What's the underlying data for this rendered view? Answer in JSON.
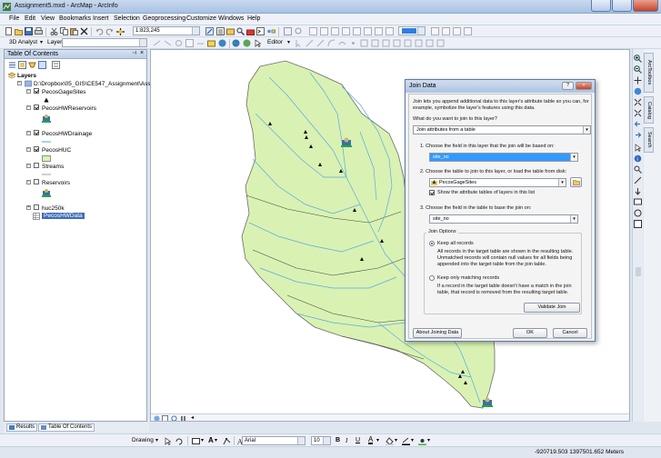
{
  "window": {
    "title": "Assignment5.mxd - ArcMap - ArcInfo"
  },
  "menu": {
    "items": [
      "File",
      "Edit",
      "View",
      "Bookmarks",
      "Insert",
      "Selection",
      "Geoprocessing",
      "Customize",
      "Windows",
      "Help"
    ]
  },
  "toolbar": {
    "scale": "1:823,245",
    "analyst_label": "3D Analyst",
    "layer_label": "Layer:",
    "editor_label": "Editor"
  },
  "toc": {
    "title": "Table Of Contents",
    "root": "Layers",
    "group": "D:\\Dropbox\\05_GIS\\CE547_Assignment\\Assignm",
    "layers": [
      {
        "label": "PecosGageSites",
        "checked": true
      },
      {
        "label": "PecosHWReservoirs",
        "checked": true
      },
      {
        "label": "PecosHWDrainage",
        "checked": true
      },
      {
        "label": "PecosHUC",
        "checked": true
      },
      {
        "label": "Streams",
        "checked": false
      },
      {
        "label": "Reservoirs",
        "checked": false
      },
      {
        "label": "huc250k",
        "checked": false
      },
      {
        "label": "PecosHWData",
        "checked": false
      }
    ]
  },
  "bottom_tabs": {
    "results": "Results",
    "toc": "Table Of Contents"
  },
  "right_tabs": {
    "arctoolbox": "ArcToolbox",
    "catalog": "Catalog",
    "search": "Search"
  },
  "drawing": {
    "drawing_label": "Drawing",
    "font": "Arial",
    "size": "10",
    "bold": "B",
    "italic": "I",
    "underline": "U"
  },
  "status": {
    "coordinates": "-920719.503  1397501.652 Meters"
  },
  "dialog": {
    "title": "Join Data",
    "intro": "Join lets you append additional data to this layer's attribute table so you can, for example, symbolize the layer's features using this data.",
    "question": "What do you want to join to this layer?",
    "join_type": "Join attributes from a table",
    "step1": "1.  Choose the field in this layer that the join will be based on:",
    "field1": "site_no",
    "step2": "2.  Choose the table to join to this layer, or load the table from disk:",
    "table": "PecosGageSites",
    "show_attr_tables": "Show the attribute tables of layers in this list",
    "step3": "3.  Choose the field in the table to base the join on:",
    "field3": "site_no",
    "options_title": "Join Options",
    "keep_all": "Keep all records",
    "keep_all_desc": "All records in the target table are shown in the resulting table. Unmatched records will contain null values for all fields being appended into the target table from the join table.",
    "keep_matching": "Keep only matching records",
    "keep_matching_desc": "If a record in the target table doesn't have a match in the join table, that record is removed from the resulting target table.",
    "validate": "Validate Join",
    "about": "About Joining Data",
    "ok": "OK",
    "cancel": "Cancel",
    "question_mark": "?",
    "close": "×"
  }
}
